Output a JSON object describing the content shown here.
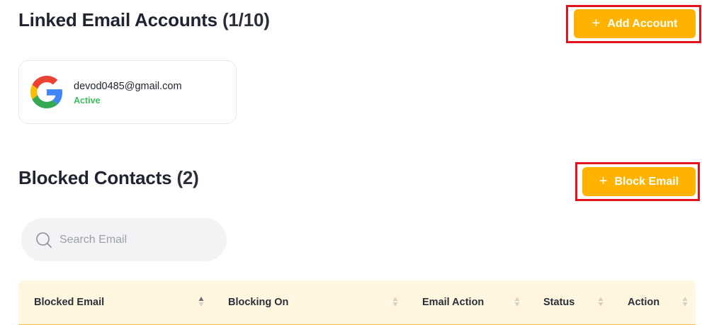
{
  "linked_accounts": {
    "title": "Linked Email Accounts",
    "count_open": "(",
    "count": "1/10",
    "count_close": ")",
    "add_button_label": "Add Account",
    "plus_symbol": "+",
    "accounts": [
      {
        "email": "devod0485@gmail.com",
        "status": "Active",
        "provider_icon": "google-icon"
      }
    ]
  },
  "blocked_contacts": {
    "title": "Blocked Contacts",
    "count_open": "(",
    "count": "2",
    "count_close": ")",
    "block_button_label": "Block Email",
    "plus_symbol": "+",
    "search": {
      "placeholder": "Search Email",
      "value": ""
    },
    "table": {
      "columns": [
        {
          "label": "Blocked Email",
          "sort": "ascending"
        },
        {
          "label": "Blocking On",
          "sort": "none"
        },
        {
          "label": "Email Action",
          "sort": "none"
        },
        {
          "label": "Status",
          "sort": "none"
        },
        {
          "label": "Action",
          "sort": "none"
        }
      ]
    }
  },
  "colors": {
    "accent": "#ffb300",
    "highlight": "#e3121c",
    "active_status": "#3cc15b",
    "table_header_bg": "#fff6df"
  }
}
